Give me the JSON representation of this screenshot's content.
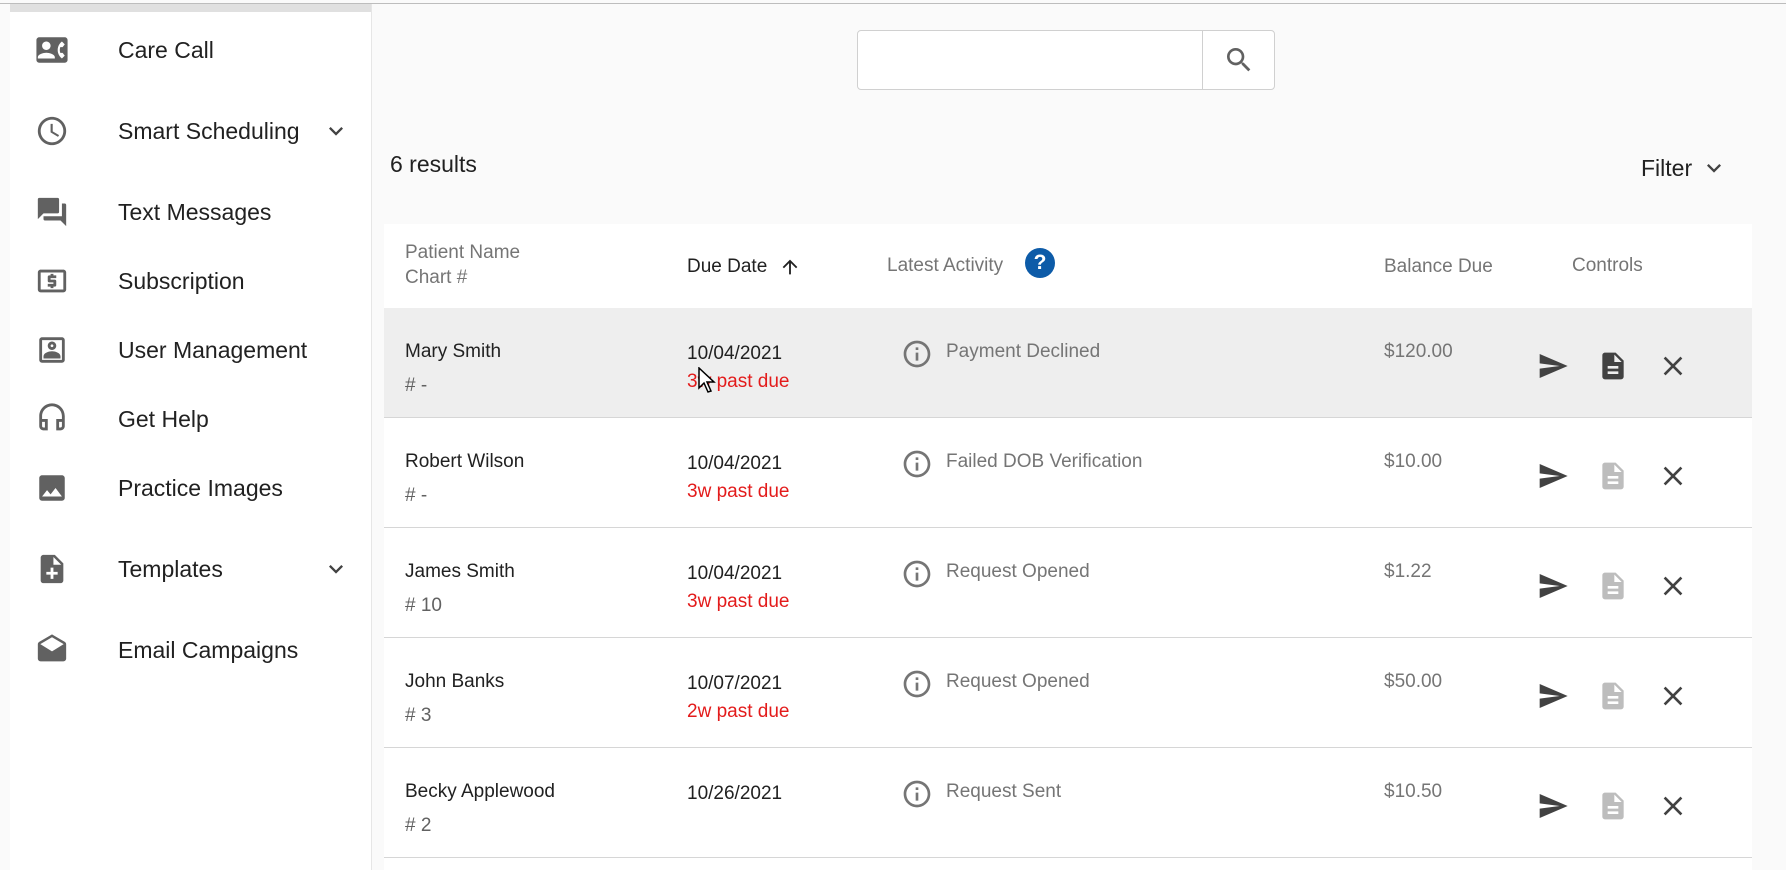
{
  "sidebar": {
    "items": [
      {
        "label": "Care Call",
        "icon": "contact-phone-icon",
        "expandable": false
      },
      {
        "label": "Smart Scheduling",
        "icon": "clock-icon",
        "expandable": true
      },
      {
        "label": "Text Messages",
        "icon": "chat-icon",
        "expandable": false
      },
      {
        "label": "Subscription",
        "icon": "dollar-card-icon",
        "expandable": false
      },
      {
        "label": "User Management",
        "icon": "account-box-icon",
        "expandable": false
      },
      {
        "label": "Get Help",
        "icon": "headset-icon",
        "expandable": false
      },
      {
        "label": "Practice Images",
        "icon": "image-icon",
        "expandable": false
      },
      {
        "label": "Templates",
        "icon": "note-add-icon",
        "expandable": true
      },
      {
        "label": "Email Campaigns",
        "icon": "drafts-icon",
        "expandable": false
      }
    ]
  },
  "search": {
    "value": "",
    "placeholder": ""
  },
  "results_label": "6 results",
  "filter_label": "Filter",
  "table": {
    "headers": {
      "patient_name": "Patient Name",
      "chart_no": "Chart #",
      "due_date": "Due Date",
      "latest_activity": "Latest Activity",
      "balance_due": "Balance Due",
      "controls": "Controls"
    },
    "sort": {
      "column": "due_date",
      "direction": "ascending"
    },
    "rows": [
      {
        "name": "Mary Smith",
        "chart": "# -",
        "due": "10/04/2021",
        "past_due": "3w past due",
        "activity": "Payment Declined",
        "balance": "$120.00",
        "doc_enabled": true,
        "highlighted": true
      },
      {
        "name": "Robert Wilson",
        "chart": "# -",
        "due": "10/04/2021",
        "past_due": "3w past due",
        "activity": "Failed DOB Verification",
        "balance": "$10.00",
        "doc_enabled": false,
        "highlighted": false
      },
      {
        "name": "James Smith",
        "chart": "# 10",
        "due": "10/04/2021",
        "past_due": "3w past due",
        "activity": "Request Opened",
        "balance": "$1.22",
        "doc_enabled": false,
        "highlighted": false
      },
      {
        "name": "John Banks",
        "chart": "# 3",
        "due": "10/07/2021",
        "past_due": "2w past due",
        "activity": "Request Opened",
        "balance": "$50.00",
        "doc_enabled": false,
        "highlighted": false
      },
      {
        "name": "Becky Applewood",
        "chart": "# 2",
        "due": "10/26/2021",
        "past_due": "",
        "activity": "Request Sent",
        "balance": "$10.50",
        "doc_enabled": false,
        "highlighted": false
      }
    ]
  },
  "colors": {
    "past_due": "#e31b1b",
    "help_icon_bg": "#0d5ba8",
    "row_highlight": "#eeeeee",
    "icon_disabled": "#bdbdbd"
  }
}
